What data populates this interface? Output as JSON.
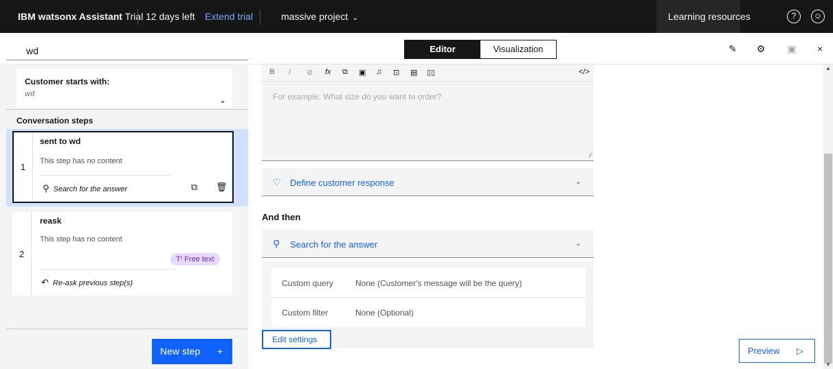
{
  "topbar": {
    "brand_bold": "IBM watsonx Assistant",
    "brand_tier": "Trial",
    "days_left": "12 days left",
    "extend_trial": "Extend trial",
    "project": "massive project",
    "learning_resources": "Learning resources"
  },
  "titlebar": {
    "step_title": "wd",
    "tabs": [
      "Editor",
      "Visualization"
    ]
  },
  "left": {
    "starts_heading": "Customer starts with:",
    "starts_value": "wd",
    "conversation_steps": "Conversation steps",
    "steps": [
      {
        "num": "1",
        "name": "sent to wd",
        "empty": "This step has no content",
        "action": "Search for the answer"
      },
      {
        "num": "2",
        "name": "reask",
        "empty": "This step has no content",
        "badge": "Free text",
        "action": "Re-ask previous step(s)"
      }
    ],
    "new_step": "New step",
    "new_step_plus": "+"
  },
  "editor": {
    "placeholder": "For example: What size do you want to order?",
    "toolbar": [
      "B",
      "I",
      "⊘",
      "fx",
      "⧉",
      "▣",
      "♫",
      "⊡",
      "▤",
      "▯▯",
      "</>"
    ]
  },
  "define_response": "Define customer response",
  "and_then": "And then",
  "search_answer": "Search for the answer",
  "settings": {
    "rows": [
      {
        "key": "Custom query",
        "value": "None (Customer's message will be the query)"
      },
      {
        "key": "Custom filter",
        "value": "None (Optional)"
      }
    ],
    "edit_button": "Edit settings"
  },
  "preview": "Preview",
  "colors": {
    "topbar": "#161616",
    "accent": "#0f62fe",
    "selection": "#d0e2ff",
    "badge_bg": "#e8daff"
  },
  "icons": [
    "help-icon",
    "user-avatar-icon",
    "edit-icon",
    "settings-icon",
    "save-icon",
    "close-icon",
    "search-icon",
    "copy-icon",
    "delete-icon",
    "user-icon",
    "chevron-down-icon",
    "return-icon",
    "play-icon"
  ]
}
